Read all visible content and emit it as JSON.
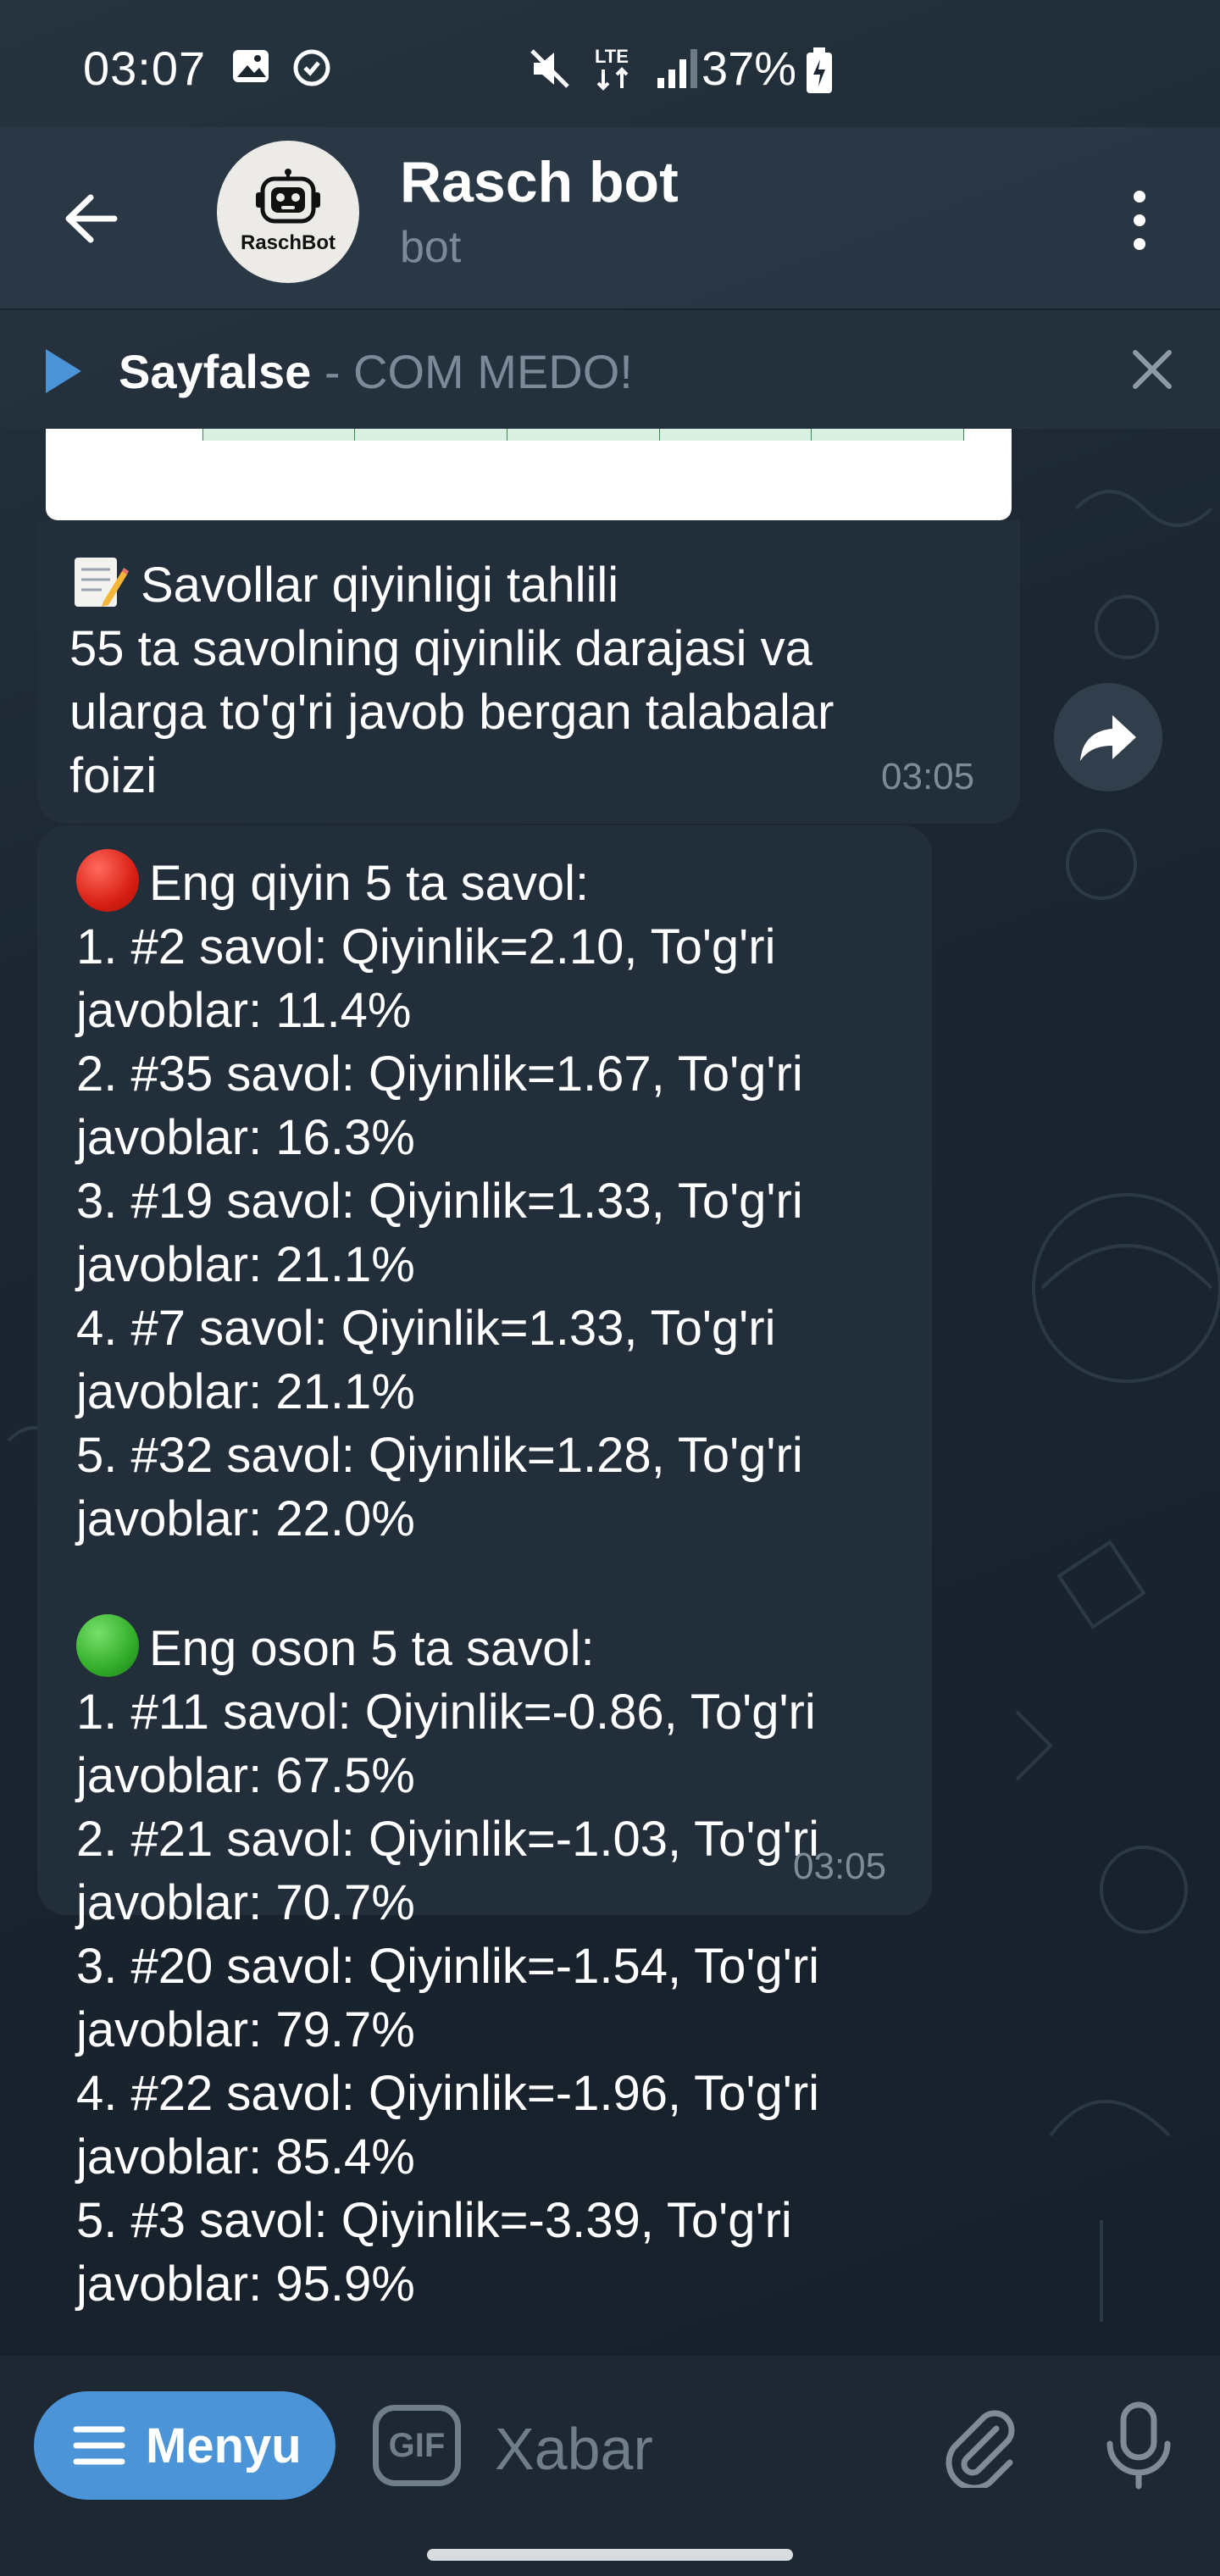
{
  "status_bar": {
    "time": "03:07",
    "battery": "37%",
    "network": "LTE"
  },
  "header": {
    "title": "Rasch bot",
    "subtitle": "bot",
    "avatar_label": "RaschBot"
  },
  "pinned": {
    "name": "Sayfalse",
    "separator": " - ",
    "text": "COM MEDO!"
  },
  "messages": [
    {
      "text": "Savollar qiyinligi tahlili\n55 ta savolning qiyinlik darajasi va\nularga to'g'ri javob bergan talabalar\nfoizi",
      "time": "03:05"
    },
    {
      "hardest_title": "Eng qiyin 5 ta savol:",
      "hardest_list": "1. #2 savol: Qiyinlik=2.10, To'g'ri\njavoblar: 11.4%\n2. #35 savol: Qiyinlik=1.67, To'g'ri\njavoblar: 16.3%\n3. #19 savol: Qiyinlik=1.33, To'g'ri\njavoblar: 21.1%\n4. #7 savol: Qiyinlik=1.33, To'g'ri\njavoblar: 21.1%\n5. #32 savol: Qiyinlik=1.28, To'g'ri\njavoblar: 22.0%",
      "easiest_title": "Eng oson 5 ta savol:",
      "easiest_list": "1. #11 savol: Qiyinlik=-0.86, To'g'ri\njavoblar: 67.5%\n2. #21 savol: Qiyinlik=-1.03, To'g'ri\njavoblar: 70.7%\n3. #20 savol: Qiyinlik=-1.54, To'g'ri\njavoblar: 79.7%\n4. #22 savol: Qiyinlik=-1.96, To'g'ri\njavoblar: 85.4%\n5. #3 savol: Qiyinlik=-3.39, To'g'ri\njavoblar: 95.9%",
      "time": "03:05"
    }
  ],
  "input": {
    "menu_label": "Menyu",
    "gif_label": "GIF",
    "placeholder": "Xabar"
  },
  "colors": {
    "background": "#1a2530",
    "bubble": "#222f3b",
    "accent": "#4b94d8",
    "secondary_text": "#7b8a99"
  }
}
